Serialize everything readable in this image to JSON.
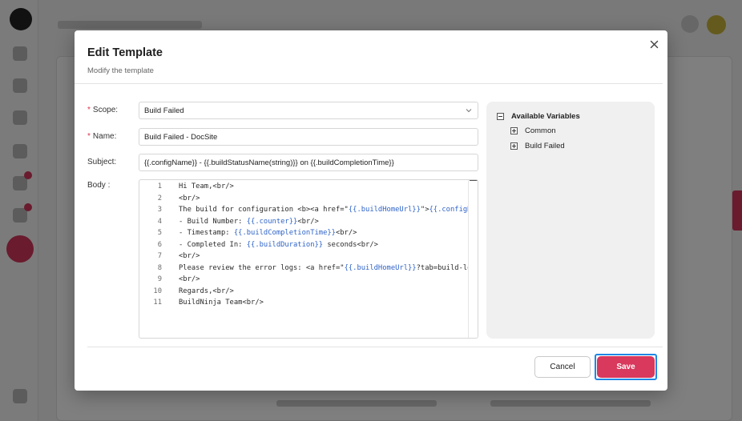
{
  "modal": {
    "title": "Edit Template",
    "subtitle": "Modify the template"
  },
  "form": {
    "scope_label": "Scope:",
    "scope_value": "Build Failed",
    "name_label": "Name:",
    "name_value": "Build Failed - DocSite",
    "subject_label": "Subject:",
    "subject_value": "{{.configName}} - {{.buildStatusName(string)}} on {{.buildCompletionTime}}",
    "body_label": "Body :",
    "required_mark": "*"
  },
  "code": {
    "lines": [
      {
        "n": "1",
        "text": "Hi Team,<br/>"
      },
      {
        "n": "2",
        "text": "<br/>"
      },
      {
        "n": "3",
        "text": "The build for configuration <b><a href=\"{{.buildHomeUrl}}\">{{.configName}}</a></b>"
      },
      {
        "n": "4",
        "text": "- Build Number: {{.counter}}<br/>"
      },
      {
        "n": "5",
        "text": "- Timestamp: {{.buildCompletionTime}}<br/>"
      },
      {
        "n": "6",
        "text": "- Completed In: {{.buildDuration}} seconds<br/>"
      },
      {
        "n": "7",
        "text": "<br/>"
      },
      {
        "n": "8",
        "text": "Please review the error logs: <a href=\"{{.buildHomeUrl}}?tab=build-log\">"
      },
      {
        "n": "9",
        "text": "<br/>"
      },
      {
        "n": "10",
        "text": "Regards,<br/>"
      },
      {
        "n": "11",
        "text": "BuildNinja Team<br/>"
      }
    ]
  },
  "variables": {
    "title": "Available Variables",
    "groups": [
      "Common",
      "Build Failed"
    ]
  },
  "actions": {
    "cancel": "Cancel",
    "save": "Save"
  },
  "icons": {
    "close": "close-icon",
    "dropdown": "chevron-down-icon",
    "collapse": "minus-box-icon",
    "expand": "plus-box-icon"
  },
  "colors": {
    "primary": "#d8395c",
    "focus": "#1e88e5",
    "variable": "#2f64c8"
  }
}
